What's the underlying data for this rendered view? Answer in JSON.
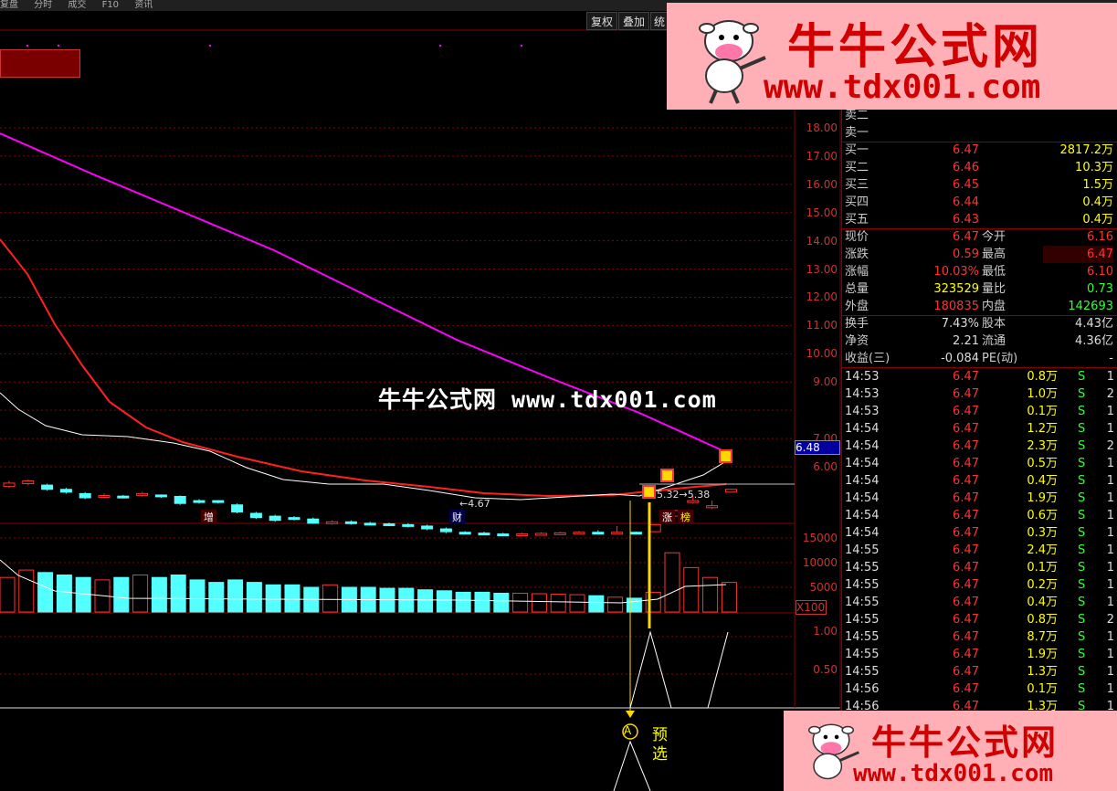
{
  "toolbar": {
    "menu": [
      "复盘",
      "分时",
      "成交",
      "F10",
      "资讯"
    ],
    "buttons": [
      "复权",
      "叠加",
      "统"
    ]
  },
  "banner": {
    "title": "牛牛公式网",
    "url": "www.tdx001.com"
  },
  "watermark": "牛牛公式网 www.tdx001.com",
  "price_axis": [
    "18.00",
    "17.00",
    "16.00",
    "15.00",
    "14.00",
    "13.00",
    "12.00",
    "11.00",
    "10.00",
    "9.00",
    "7.00",
    "6.00"
  ],
  "current_price_tag": "6.48",
  "volume_axis": [
    "15000",
    "10000",
    "5000"
  ],
  "volume_unit": "X100",
  "indicator_axis": [
    "1.00",
    "0.50"
  ],
  "chart_annotations": {
    "low_label": "←4.67",
    "range_label": "5.32→5.38",
    "markers": [
      "增",
      "财",
      "涨",
      "榜"
    ],
    "signal_letter": "A",
    "signal_text": "预选"
  },
  "chart_data": {
    "type": "candlestick",
    "y_range": [
      4.5,
      18.8
    ],
    "candles": [
      {
        "o": 5.3,
        "c": 5.42,
        "h": 5.5,
        "l": 5.25
      },
      {
        "o": 5.4,
        "c": 5.5,
        "h": 5.55,
        "l": 5.35
      },
      {
        "o": 5.35,
        "c": 5.2,
        "h": 5.4,
        "l": 5.15
      },
      {
        "o": 5.2,
        "c": 5.1,
        "h": 5.25,
        "l": 5.05
      },
      {
        "o": 5.05,
        "c": 4.9,
        "h": 5.1,
        "l": 4.85
      },
      {
        "o": 4.95,
        "c": 4.98,
        "h": 5.05,
        "l": 4.88
      },
      {
        "o": 4.96,
        "c": 4.92,
        "h": 5.0,
        "l": 4.88
      },
      {
        "o": 5.0,
        "c": 5.05,
        "h": 5.1,
        "l": 4.95
      },
      {
        "o": 5.0,
        "c": 4.95,
        "h": 5.02,
        "l": 4.9
      },
      {
        "o": 4.95,
        "c": 4.7,
        "h": 4.98,
        "l": 4.65
      },
      {
        "o": 4.8,
        "c": 4.75,
        "h": 4.85,
        "l": 4.7
      },
      {
        "o": 4.8,
        "c": 4.75,
        "h": 4.82,
        "l": 4.7
      },
      {
        "o": 4.65,
        "c": 4.4,
        "h": 4.7,
        "l": 4.35
      },
      {
        "o": 4.35,
        "c": 4.2,
        "h": 4.4,
        "l": 4.15
      },
      {
        "o": 4.25,
        "c": 4.1,
        "h": 4.3,
        "l": 4.05
      },
      {
        "o": 4.2,
        "c": 4.15,
        "h": 4.25,
        "l": 4.1
      },
      {
        "o": 4.15,
        "c": 4.0,
        "h": 4.2,
        "l": 3.98
      },
      {
        "o": 4.0,
        "c": 4.05,
        "h": 4.1,
        "l": 3.95
      },
      {
        "o": 4.05,
        "c": 4.0,
        "h": 4.1,
        "l": 3.95
      },
      {
        "o": 4.0,
        "c": 3.98,
        "h": 4.05,
        "l": 3.93
      },
      {
        "o": 3.98,
        "c": 3.95,
        "h": 4.02,
        "l": 3.9
      },
      {
        "o": 3.95,
        "c": 3.9,
        "h": 4.0,
        "l": 3.85
      },
      {
        "o": 3.9,
        "c": 3.8,
        "h": 3.95,
        "l": 3.75
      },
      {
        "o": 3.8,
        "c": 3.7,
        "h": 3.85,
        "l": 3.65
      },
      {
        "o": 3.68,
        "c": 3.65,
        "h": 3.72,
        "l": 3.62
      },
      {
        "o": 3.65,
        "c": 3.63,
        "h": 3.7,
        "l": 3.6
      },
      {
        "o": 3.62,
        "c": 3.6,
        "h": 3.66,
        "l": 3.58
      },
      {
        "o": 3.6,
        "c": 3.62,
        "h": 3.66,
        "l": 3.57
      },
      {
        "o": 3.62,
        "c": 3.64,
        "h": 3.68,
        "l": 3.6
      },
      {
        "o": 3.64,
        "c": 3.66,
        "h": 3.7,
        "l": 3.62
      },
      {
        "o": 3.66,
        "c": 3.68,
        "h": 3.72,
        "l": 3.64
      },
      {
        "o": 3.68,
        "c": 3.66,
        "h": 3.75,
        "l": 3.64
      },
      {
        "o": 3.66,
        "c": 3.68,
        "h": 3.9,
        "l": 3.64
      },
      {
        "o": 3.68,
        "c": 3.63,
        "h": 3.7,
        "l": 3.6
      },
      {
        "o": 3.7,
        "c": 3.95,
        "h": 3.95,
        "l": 3.68
      },
      {
        "o": 4.25,
        "c": 4.45,
        "h": 4.45,
        "l": 4.25
      },
      {
        "o": 4.75,
        "c": 4.8,
        "h": 4.95,
        "l": 4.7
      },
      {
        "o": 4.55,
        "c": 4.62,
        "h": 4.8,
        "l": 4.5
      },
      {
        "o": 5.1,
        "c": 5.2,
        "h": 5.22,
        "l": 5.1
      }
    ],
    "volume_range": [
      0,
      17500
    ],
    "volume": [
      7000,
      8500,
      8000,
      7500,
      7000,
      6500,
      7000,
      7500,
      7000,
      7500,
      6500,
      6000,
      6500,
      6000,
      5500,
      5500,
      5000,
      5500,
      5000,
      5000,
      4800,
      4800,
      4500,
      4300,
      4000,
      4000,
      3800,
      3800,
      3700,
      3600,
      3500,
      3300,
      3000,
      2800,
      4000,
      12000,
      9000,
      7000,
      6000
    ]
  },
  "quote_panel": {
    "sell": [
      {
        "label": "卖二",
        "price": "",
        "vol": ""
      },
      {
        "label": "卖一",
        "price": "",
        "vol": ""
      }
    ],
    "buy": [
      {
        "label": "买一",
        "price": "6.47",
        "vol": "2817.2万"
      },
      {
        "label": "买二",
        "price": "6.46",
        "vol": "10.3万"
      },
      {
        "label": "买三",
        "price": "6.45",
        "vol": "1.5万"
      },
      {
        "label": "买四",
        "price": "6.44",
        "vol": "0.4万"
      },
      {
        "label": "买五",
        "price": "6.43",
        "vol": "0.4万"
      }
    ],
    "stats": [
      {
        "l1": "现价",
        "v1": "6.47",
        "l2": "今开",
        "v2": "6.16"
      },
      {
        "l1": "涨跌",
        "v1": "0.59",
        "l2": "最高",
        "v2": "6.47"
      },
      {
        "l1": "涨幅",
        "v1": "10.03%",
        "l2": "最低",
        "v2": "6.10"
      },
      {
        "l1": "总量",
        "v1": "323529",
        "l2": "量比",
        "v2": "0.73"
      },
      {
        "l1": "外盘",
        "v1": "180835",
        "l2": "内盘",
        "v2": "142693"
      }
    ],
    "fundamentals": [
      {
        "l1": "换手",
        "v1": "7.43%",
        "l2": "股本",
        "v2": "4.43亿"
      },
      {
        "l1": "净资",
        "v1": "2.21",
        "l2": "流通",
        "v2": "4.36亿"
      },
      {
        "l1": "收益(三)",
        "v1": "-0.084",
        "l2": "PE(动)",
        "v2": "-"
      }
    ],
    "ticks": [
      {
        "t": "14:53",
        "p": "6.47",
        "v": "0.8万",
        "s": "S",
        "n": "1"
      },
      {
        "t": "14:53",
        "p": "6.47",
        "v": "1.0万",
        "s": "S",
        "n": "2"
      },
      {
        "t": "14:53",
        "p": "6.47",
        "v": "0.1万",
        "s": "S",
        "n": "1"
      },
      {
        "t": "14:54",
        "p": "6.47",
        "v": "1.2万",
        "s": "S",
        "n": "1"
      },
      {
        "t": "14:54",
        "p": "6.47",
        "v": "2.3万",
        "s": "S",
        "n": "2"
      },
      {
        "t": "14:54",
        "p": "6.47",
        "v": "0.5万",
        "s": "S",
        "n": "1"
      },
      {
        "t": "14:54",
        "p": "6.47",
        "v": "0.4万",
        "s": "S",
        "n": "1"
      },
      {
        "t": "14:54",
        "p": "6.47",
        "v": "1.9万",
        "s": "S",
        "n": "1"
      },
      {
        "t": "14:54",
        "p": "6.47",
        "v": "0.6万",
        "s": "S",
        "n": "1"
      },
      {
        "t": "14:54",
        "p": "6.47",
        "v": "0.3万",
        "s": "S",
        "n": "1"
      },
      {
        "t": "14:55",
        "p": "6.47",
        "v": "2.4万",
        "s": "S",
        "n": "1"
      },
      {
        "t": "14:55",
        "p": "6.47",
        "v": "0.1万",
        "s": "S",
        "n": "1"
      },
      {
        "t": "14:55",
        "p": "6.47",
        "v": "0.2万",
        "s": "S",
        "n": "1"
      },
      {
        "t": "14:55",
        "p": "6.47",
        "v": "0.4万",
        "s": "S",
        "n": "1"
      },
      {
        "t": "14:55",
        "p": "6.47",
        "v": "0.8万",
        "s": "S",
        "n": "2"
      },
      {
        "t": "14:55",
        "p": "6.47",
        "v": "8.7万",
        "s": "S",
        "n": "1"
      },
      {
        "t": "14:55",
        "p": "6.47",
        "v": "1.9万",
        "s": "S",
        "n": "1"
      },
      {
        "t": "14:55",
        "p": "6.47",
        "v": "1.3万",
        "s": "S",
        "n": "1"
      },
      {
        "t": "14:56",
        "p": "6.47",
        "v": "0.1万",
        "s": "S",
        "n": "1"
      },
      {
        "t": "14:56",
        "p": "6.47",
        "v": "1.3万",
        "s": "S",
        "n": "1"
      }
    ]
  },
  "colors": {
    "up": "#ff3232",
    "down": "#54ffff",
    "ma_long": "#ff00ff",
    "ma_mid": "#ff2020",
    "ma_short": "#ffffff",
    "grid": "#8b0000",
    "price_text": "#ff3232",
    "volume_text": "#ffff00",
    "green_text": "#33ff33"
  }
}
